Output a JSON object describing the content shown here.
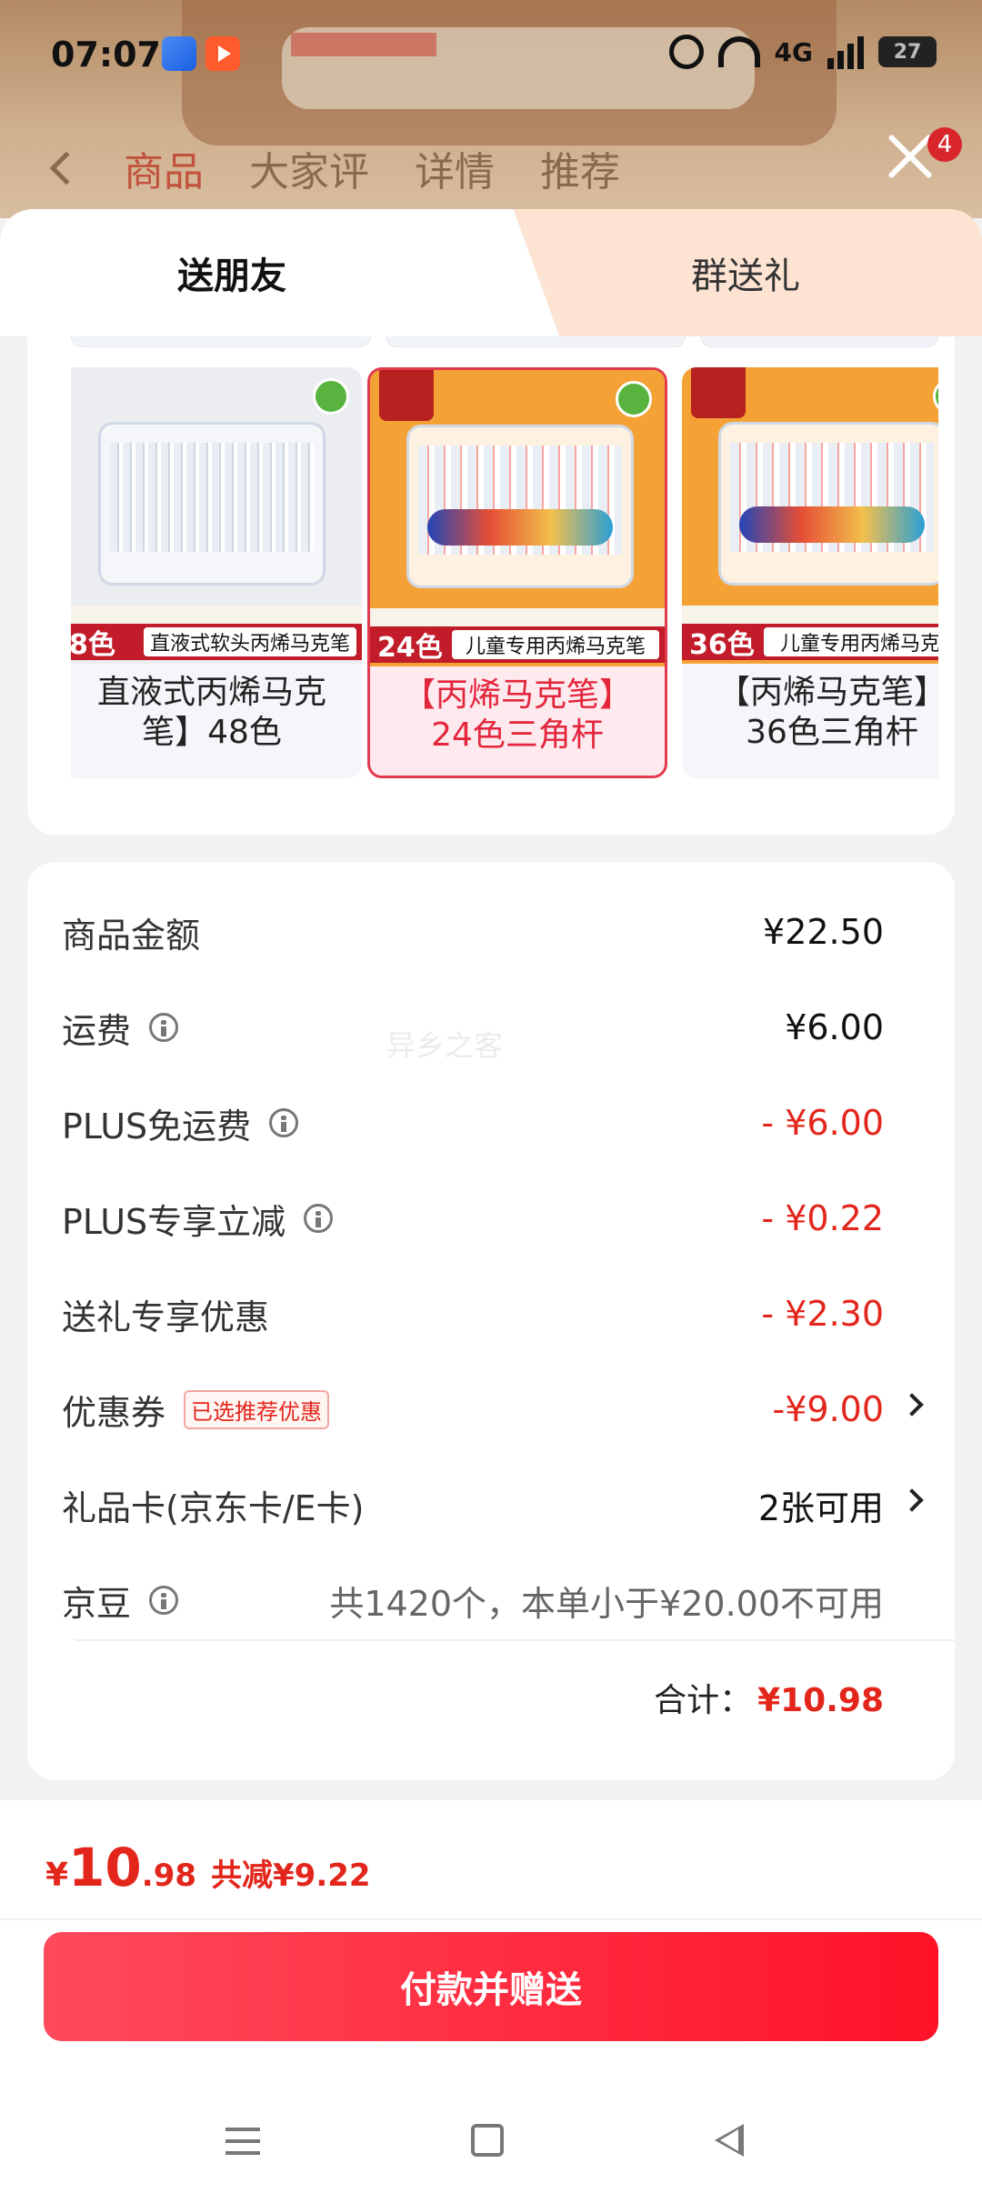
{
  "status_bar": {
    "time": "07:07",
    "network": "4G",
    "battery": "27"
  },
  "background_nav": {
    "tabs": [
      "商品",
      "大家评",
      "详情",
      "推荐"
    ],
    "badge": "4"
  },
  "sheet_tabs": {
    "left": "送朋友",
    "right": "群送礼"
  },
  "products": [
    {
      "count": "8色",
      "title": "直液式软头丙烯马克笔",
      "name_line1": "直液式丙烯马克",
      "name_line2": "笔】48色",
      "selected": false
    },
    {
      "count": "24色",
      "title": "儿童专用丙烯马克笔",
      "name_line1": "【丙烯马克笔】",
      "name_line2": "24色三角杆",
      "selected": true
    },
    {
      "count": "36色",
      "title": "儿童专用丙烯马克笔",
      "name_line1": "【丙烯马克笔】",
      "name_line2": "36色三角杆",
      "selected": false
    }
  ],
  "fees": {
    "goods_amount": {
      "label": "商品金额",
      "value": "¥22.50"
    },
    "shipping": {
      "label": "运费",
      "value": "¥6.00"
    },
    "plus_free_ship": {
      "label": "PLUS免运费",
      "value": "- ¥6.00"
    },
    "plus_discount": {
      "label": "PLUS专享立减",
      "value": "- ¥0.22"
    },
    "gift_discount": {
      "label": "送礼专享优惠",
      "value": "- ¥2.30"
    },
    "coupon": {
      "label": "优惠券",
      "tag": "已选推荐优惠",
      "value": "-¥9.00"
    },
    "gift_card": {
      "label": "礼品卡(京东卡/E卡)",
      "value": "2张可用"
    },
    "jd_beans": {
      "label": "京豆",
      "note": "共1420个，本单小于¥20.00不可用"
    },
    "total_label": "合计：",
    "total_value": "¥10.98"
  },
  "bottom_bar": {
    "currency": "¥",
    "price_int": "10",
    "price_dec": ".98",
    "saved": "共减¥9.22",
    "pay_button": "付款并赠送"
  },
  "watermark": "异乡之客",
  "colors": {
    "accent": "#e3261c",
    "pay_button": "#ff1e34"
  }
}
